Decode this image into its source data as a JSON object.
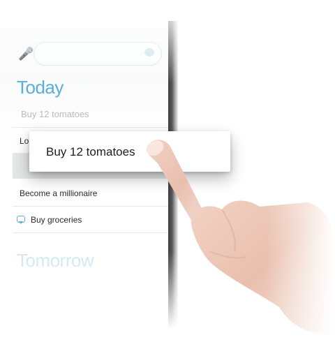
{
  "search": {
    "placeholder": ""
  },
  "sections": {
    "today": "Today",
    "tomorrow": "Tomorrow"
  },
  "items": {
    "faded": "Buy 12 tomatoes",
    "partial": "Lo",
    "millionaire": "Become a millionaire",
    "groceries": "Buy groceries"
  },
  "dragged_card": {
    "label": "Buy 12 tomatoes"
  },
  "icons": {
    "mic": "microphone-icon",
    "chat": "chat-bubble-icon"
  },
  "colors": {
    "accent": "#5aaed8"
  }
}
